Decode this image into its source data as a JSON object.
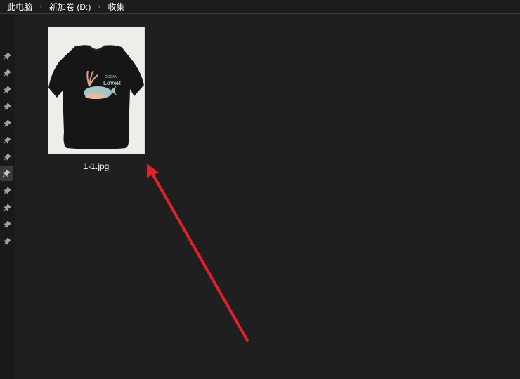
{
  "breadcrumb": {
    "items": [
      "此电脑",
      "新加卷 (D:)",
      "收集"
    ]
  },
  "file": {
    "name": "1-1.jpg",
    "print_line1": "OCEAN",
    "print_line2": "LoVeR"
  },
  "colors": {
    "background": "#1f1f1f",
    "arrow": "#e0202a",
    "shirt": "#1a1a1a"
  },
  "nav": {
    "pin_count": 12,
    "active_pin_index": 7
  }
}
